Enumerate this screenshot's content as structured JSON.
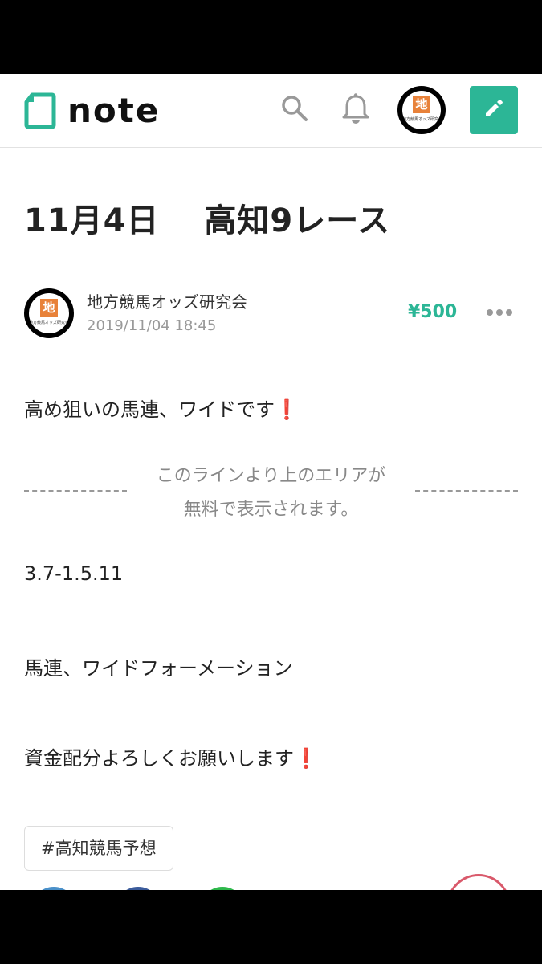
{
  "header": {
    "logo_text": "note",
    "icons": [
      "note-logo-icon",
      "search-icon",
      "bell-icon",
      "pencil-icon"
    ],
    "avatar_badge": "地",
    "avatar_caption": "地方競馬オッズ研究会"
  },
  "article": {
    "title": "11月4日　 高知9レース",
    "author": "地方競馬オッズ研究会",
    "date": "2019/11/04 18:45",
    "price": "¥500",
    "intro": "高め狙いの馬連、ワイドです",
    "intro_mark": "❗",
    "paywall_line1": "このラインより上のエリアが",
    "paywall_line2": "無料で表示されます。",
    "numbers": "3.7-1.5.11",
    "bet_type": "馬連、ワイドフォーメーション",
    "closing": "資金配分よろしくお願いします",
    "closing_mark": "❗",
    "tag": "#高知競馬予想"
  },
  "colors": {
    "accent": "#2cb696",
    "text": "#222222",
    "muted": "#999999",
    "exclaim": "#e0262e",
    "background": "#ffffff",
    "letterbox": "#000000"
  }
}
